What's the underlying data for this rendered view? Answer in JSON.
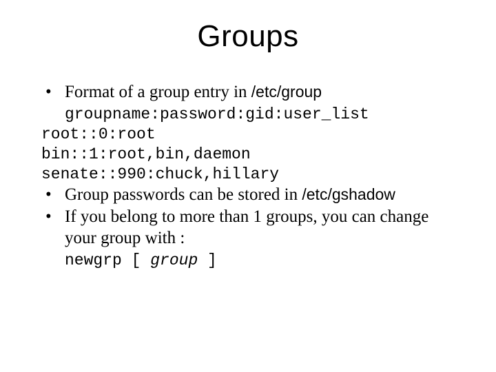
{
  "title": "Groups",
  "lines": {
    "b1_pre": "Format of a group entry in ",
    "b1_path": "/etc/group",
    "format_line": "groupname:password:gid:user_list",
    "code1": "root::0:root",
    "code2": "bin::1:root,bin,daemon",
    "code3": "senate::990:chuck,hillary",
    "b2_pre": "Group passwords can be stored in ",
    "b2_path": "/etc/gshadow",
    "b3": "If you belong to more than 1 groups, you can change your group with :",
    "newgrp_cmd": "newgrp [ ",
    "newgrp_arg": "group",
    "newgrp_end": " ]"
  }
}
